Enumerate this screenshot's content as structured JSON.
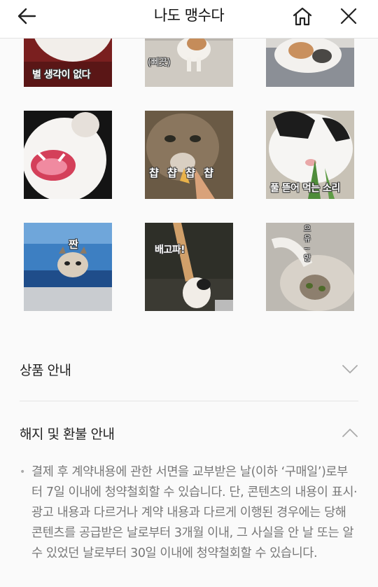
{
  "header": {
    "title": "나도 맹수다",
    "back_icon": "arrow-left-icon",
    "home_icon": "home-icon",
    "close_icon": "close-icon"
  },
  "stickers": [
    {
      "caption": "별 생각이 없다"
    },
    {
      "caption": "(삐끗)"
    },
    {
      "caption": ""
    },
    {
      "caption": ""
    },
    {
      "caption": "챱 챱 챱 챱"
    },
    {
      "caption": "풀 뜯어 먹는 소리"
    },
    {
      "caption": "짠"
    },
    {
      "caption": "배고파!"
    },
    {
      "caption": "으 유 ~ 앙"
    }
  ],
  "sections": {
    "product_info": {
      "label": "상품 안내",
      "icon": "chevron-down-icon"
    },
    "refund_info": {
      "label": "해지 및 환불 안내",
      "icon": "chevron-up-icon"
    }
  },
  "notice": {
    "bullet": "•",
    "text": "결제 후 계약내용에 관한 서면을 교부받은 날(이하 ‘구매일’)로부터 7일 이내에 청약철회할 수 있습니다. 단, 콘텐츠의 내용이 표시·광고 내용과 다르거나 계약 내용과 다르게 이행된 경우에는 당해 콘텐츠를 공급받은 날로부터 3개월 이내, 그 사실을 안 날 또는 알 수 있었던 날로부터 30일 이내에 청약철회할 수 있습니다."
  }
}
